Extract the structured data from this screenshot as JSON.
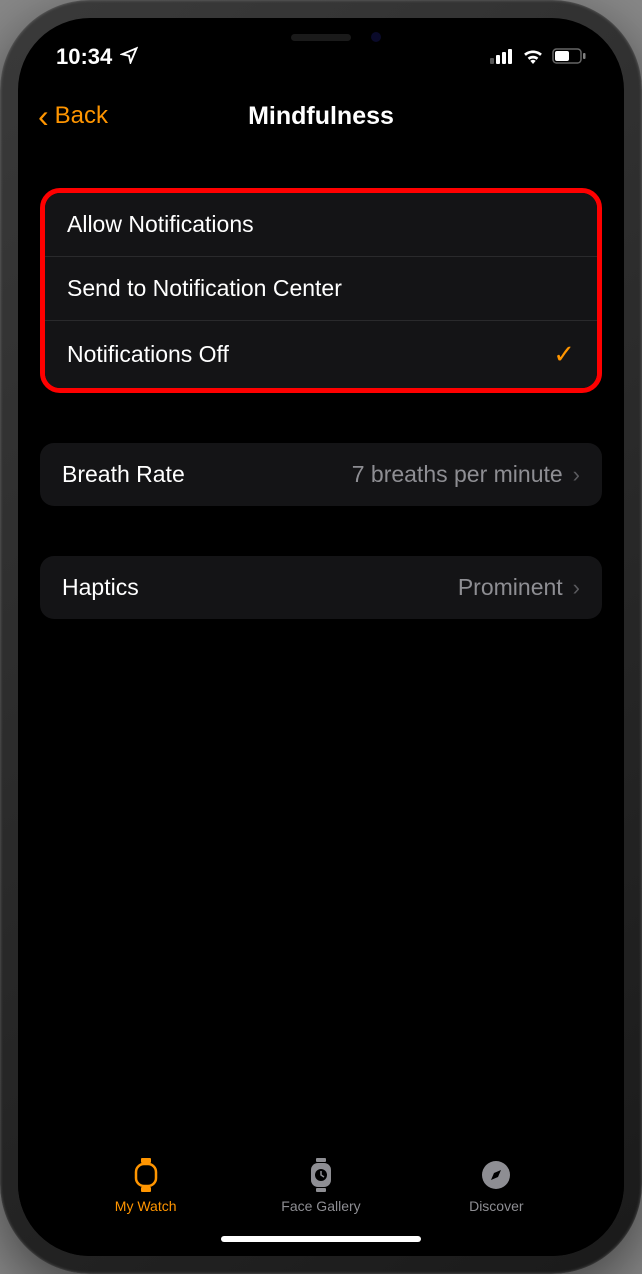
{
  "status_bar": {
    "time": "10:34"
  },
  "nav": {
    "back_label": "Back",
    "title": "Mindfulness"
  },
  "notification_options": [
    {
      "label": "Allow Notifications",
      "selected": false
    },
    {
      "label": "Send to Notification Center",
      "selected": false
    },
    {
      "label": "Notifications Off",
      "selected": true
    }
  ],
  "breath_rate": {
    "label": "Breath Rate",
    "value": "7 breaths per minute"
  },
  "haptics": {
    "label": "Haptics",
    "value": "Prominent"
  },
  "tabs": [
    {
      "label": "My Watch",
      "active": true
    },
    {
      "label": "Face Gallery",
      "active": false
    },
    {
      "label": "Discover",
      "active": false
    }
  ],
  "colors": {
    "accent": "#ff9500",
    "highlight": "#ff0000"
  }
}
